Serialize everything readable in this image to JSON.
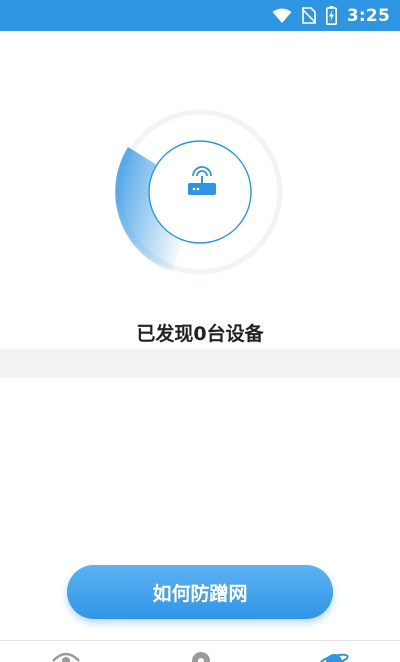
{
  "status_bar": {
    "time": "3:25",
    "icons": [
      "wifi-icon",
      "no-sim-icon",
      "battery-charging-icon"
    ],
    "background_color": "#2d95e2"
  },
  "scan": {
    "found_text": "已发现0台设备",
    "device_icon": "router-icon",
    "accent_color": "#2d95e2"
  },
  "actions": {
    "help_button_label": "如何防蹭网"
  },
  "bottom_nav": {
    "items": [
      {
        "icon": "eye-icon"
      },
      {
        "icon": "location-icon"
      },
      {
        "icon": "planet-icon",
        "active": true
      }
    ]
  }
}
